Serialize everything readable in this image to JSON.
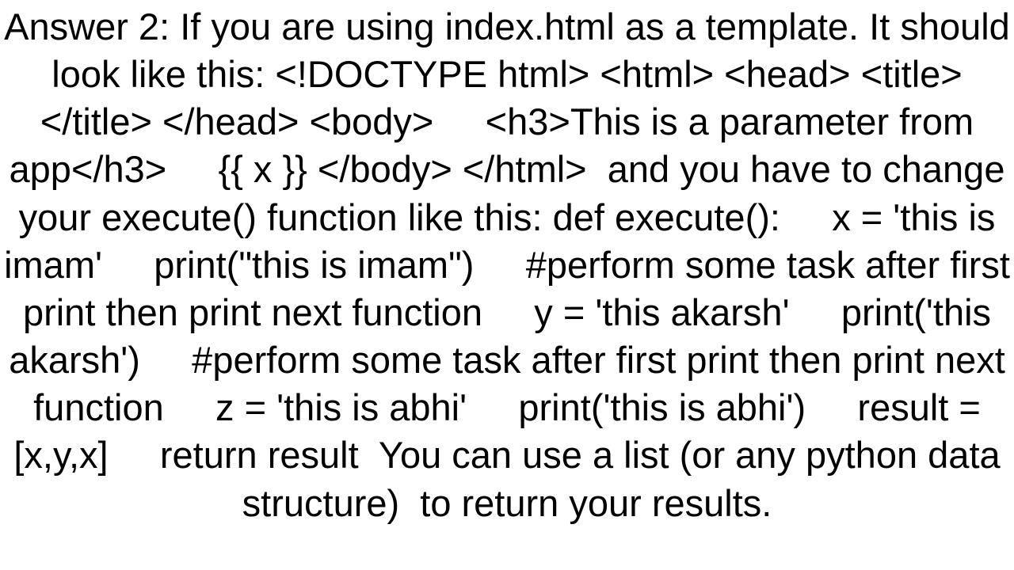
{
  "answer": {
    "text": "Answer 2: If you are using index.html as a template. It should look like this: <!DOCTYPE html> <html> <head> <title></title> </head> <body>     <h3>This is a parameter from app</h3>     {{ x }} </body> </html>  and you have to change your execute() function like this: def execute():     x = 'this is imam'     print(\"this is imam\")     #perform some task after first print then print next function     y = 'this akarsh'     print('this akarsh')     #perform some task after first print then print next function     z = 'this is abhi'     print('this is abhi')     result = [x,y,x]     return result  You can use a list (or any python data structure)  to return your results."
  }
}
